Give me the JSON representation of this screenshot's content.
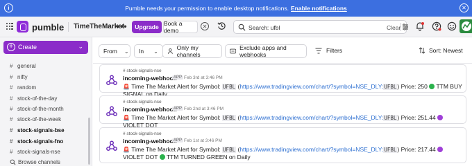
{
  "notification": {
    "message": "Pumble needs your permission to enable desktop notifications.",
    "link": "Enable notifications"
  },
  "header": {
    "logo_text": "pumble",
    "workspace_name": "TimeTheMarket",
    "more": "•••",
    "upgrade_label": "Upgrade",
    "demo_label": "Book a demo",
    "search": {
      "query": "Search: ufbl",
      "clear_label": "Clear"
    }
  },
  "sidebar": {
    "create_label": "Create",
    "channels": [
      {
        "name": "general",
        "bold": false
      },
      {
        "name": "nifty",
        "bold": false
      },
      {
        "name": "random",
        "bold": false
      },
      {
        "name": "stock-of-the-day",
        "bold": false
      },
      {
        "name": "stock-of-the-month",
        "bold": false
      },
      {
        "name": "stock-of-the-week",
        "bold": false
      },
      {
        "name": "stock-signals-bse",
        "bold": true
      },
      {
        "name": "stock-signals-fno",
        "bold": true
      },
      {
        "name": "stock-signals-nse",
        "bold": false
      }
    ],
    "browse_label": "Browse channels"
  },
  "toolbar": {
    "from_label": "From",
    "in_label": "In",
    "my_channels_label": "Only my channels",
    "exclude_webhooks_label": "Exclude apps and webhooks",
    "filters_label": "Filters",
    "sort_label": "Sort: Newest"
  },
  "messages": [
    {
      "channel": "stock-signals-nse",
      "author": "incoming-webhook",
      "badge": "APP",
      "time": "Feb 3rd at 3:46 PM",
      "prefix": "Time The Market Alert for Symbol:",
      "symbol": "UFBL",
      "url": "https://www.tradingview.com/chart/?symbol=NSE_DLY:",
      "url_symbol": "UFBL",
      "price_text": "Price: 250",
      "dot_color": "#2bb24c",
      "signal": "TTM BUY SIGNAL on Daily"
    },
    {
      "channel": "stock-signals-nse",
      "author": "incoming-webhook",
      "badge": "APP",
      "time": "Feb 2nd at 3:46 PM",
      "prefix": "Time The Market Alert for Symbol:",
      "symbol": "UFBL",
      "url": "https://www.tradingview.com/chart/?symbol=NSE_DLY:",
      "url_symbol": "UFBL",
      "price_text": "Price: 251.44",
      "dot_color": "#a040d8",
      "signal": "VIOLET DOT"
    },
    {
      "channel": "stock-signals-nse",
      "author": "incoming-webhook",
      "badge": "APP",
      "time": "Feb 1st at 3:46 PM",
      "prefix": "Time The Market Alert for Symbol:",
      "symbol": "UFBL",
      "url": "https://www.tradingview.com/chart/?symbol=NSE_DLY:",
      "url_symbol": "UFBL",
      "price_text": "Price: 217.44",
      "dot_color": "#a040d8",
      "signal": "VIOLET DOT",
      "dot2_color": "#2bb24c",
      "signal2": "TTM TURNED GREEN on Daily"
    }
  ],
  "colors": {
    "brand": "#8b2cc9",
    "notification_bar": "#3c6fe0",
    "link": "#2d6fd1"
  }
}
